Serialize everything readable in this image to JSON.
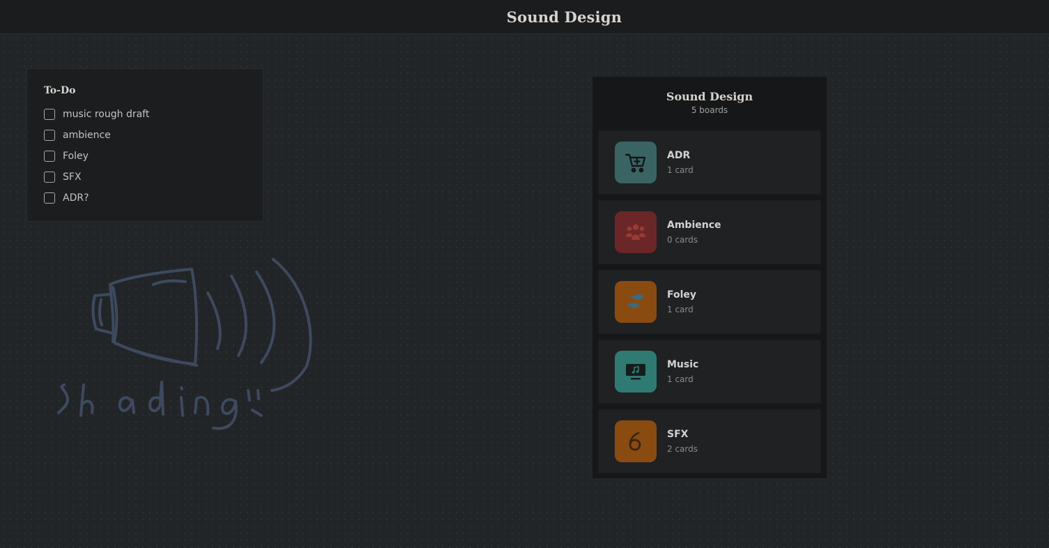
{
  "app": {
    "title": "Sound Design"
  },
  "todo": {
    "title": "To-Do",
    "items": [
      {
        "label": "music rough draft",
        "checked": false
      },
      {
        "label": "ambience",
        "checked": false
      },
      {
        "label": "Foley",
        "checked": false
      },
      {
        "label": "SFX",
        "checked": false
      },
      {
        "label": "ADR?",
        "checked": false
      }
    ]
  },
  "sketch": {
    "text": "shading"
  },
  "boards": {
    "title": "Sound Design",
    "count": "5 boards",
    "items": [
      {
        "name": "ADR",
        "cards": "1 card",
        "color": "#3a6464",
        "icon": "shopping-cart-icon"
      },
      {
        "name": "Ambience",
        "cards": "0 cards",
        "color": "#6b2727",
        "icon": "people-group-icon"
      },
      {
        "name": "Foley",
        "cards": "1 card",
        "color": "#8a4b10",
        "icon": "footprints-icon"
      },
      {
        "name": "Music",
        "cards": "1 card",
        "color": "#2f7b73",
        "icon": "music-monitor-icon"
      },
      {
        "name": "SFX",
        "cards": "2 cards",
        "color": "#8a4b10",
        "icon": "number-six-icon"
      }
    ]
  }
}
